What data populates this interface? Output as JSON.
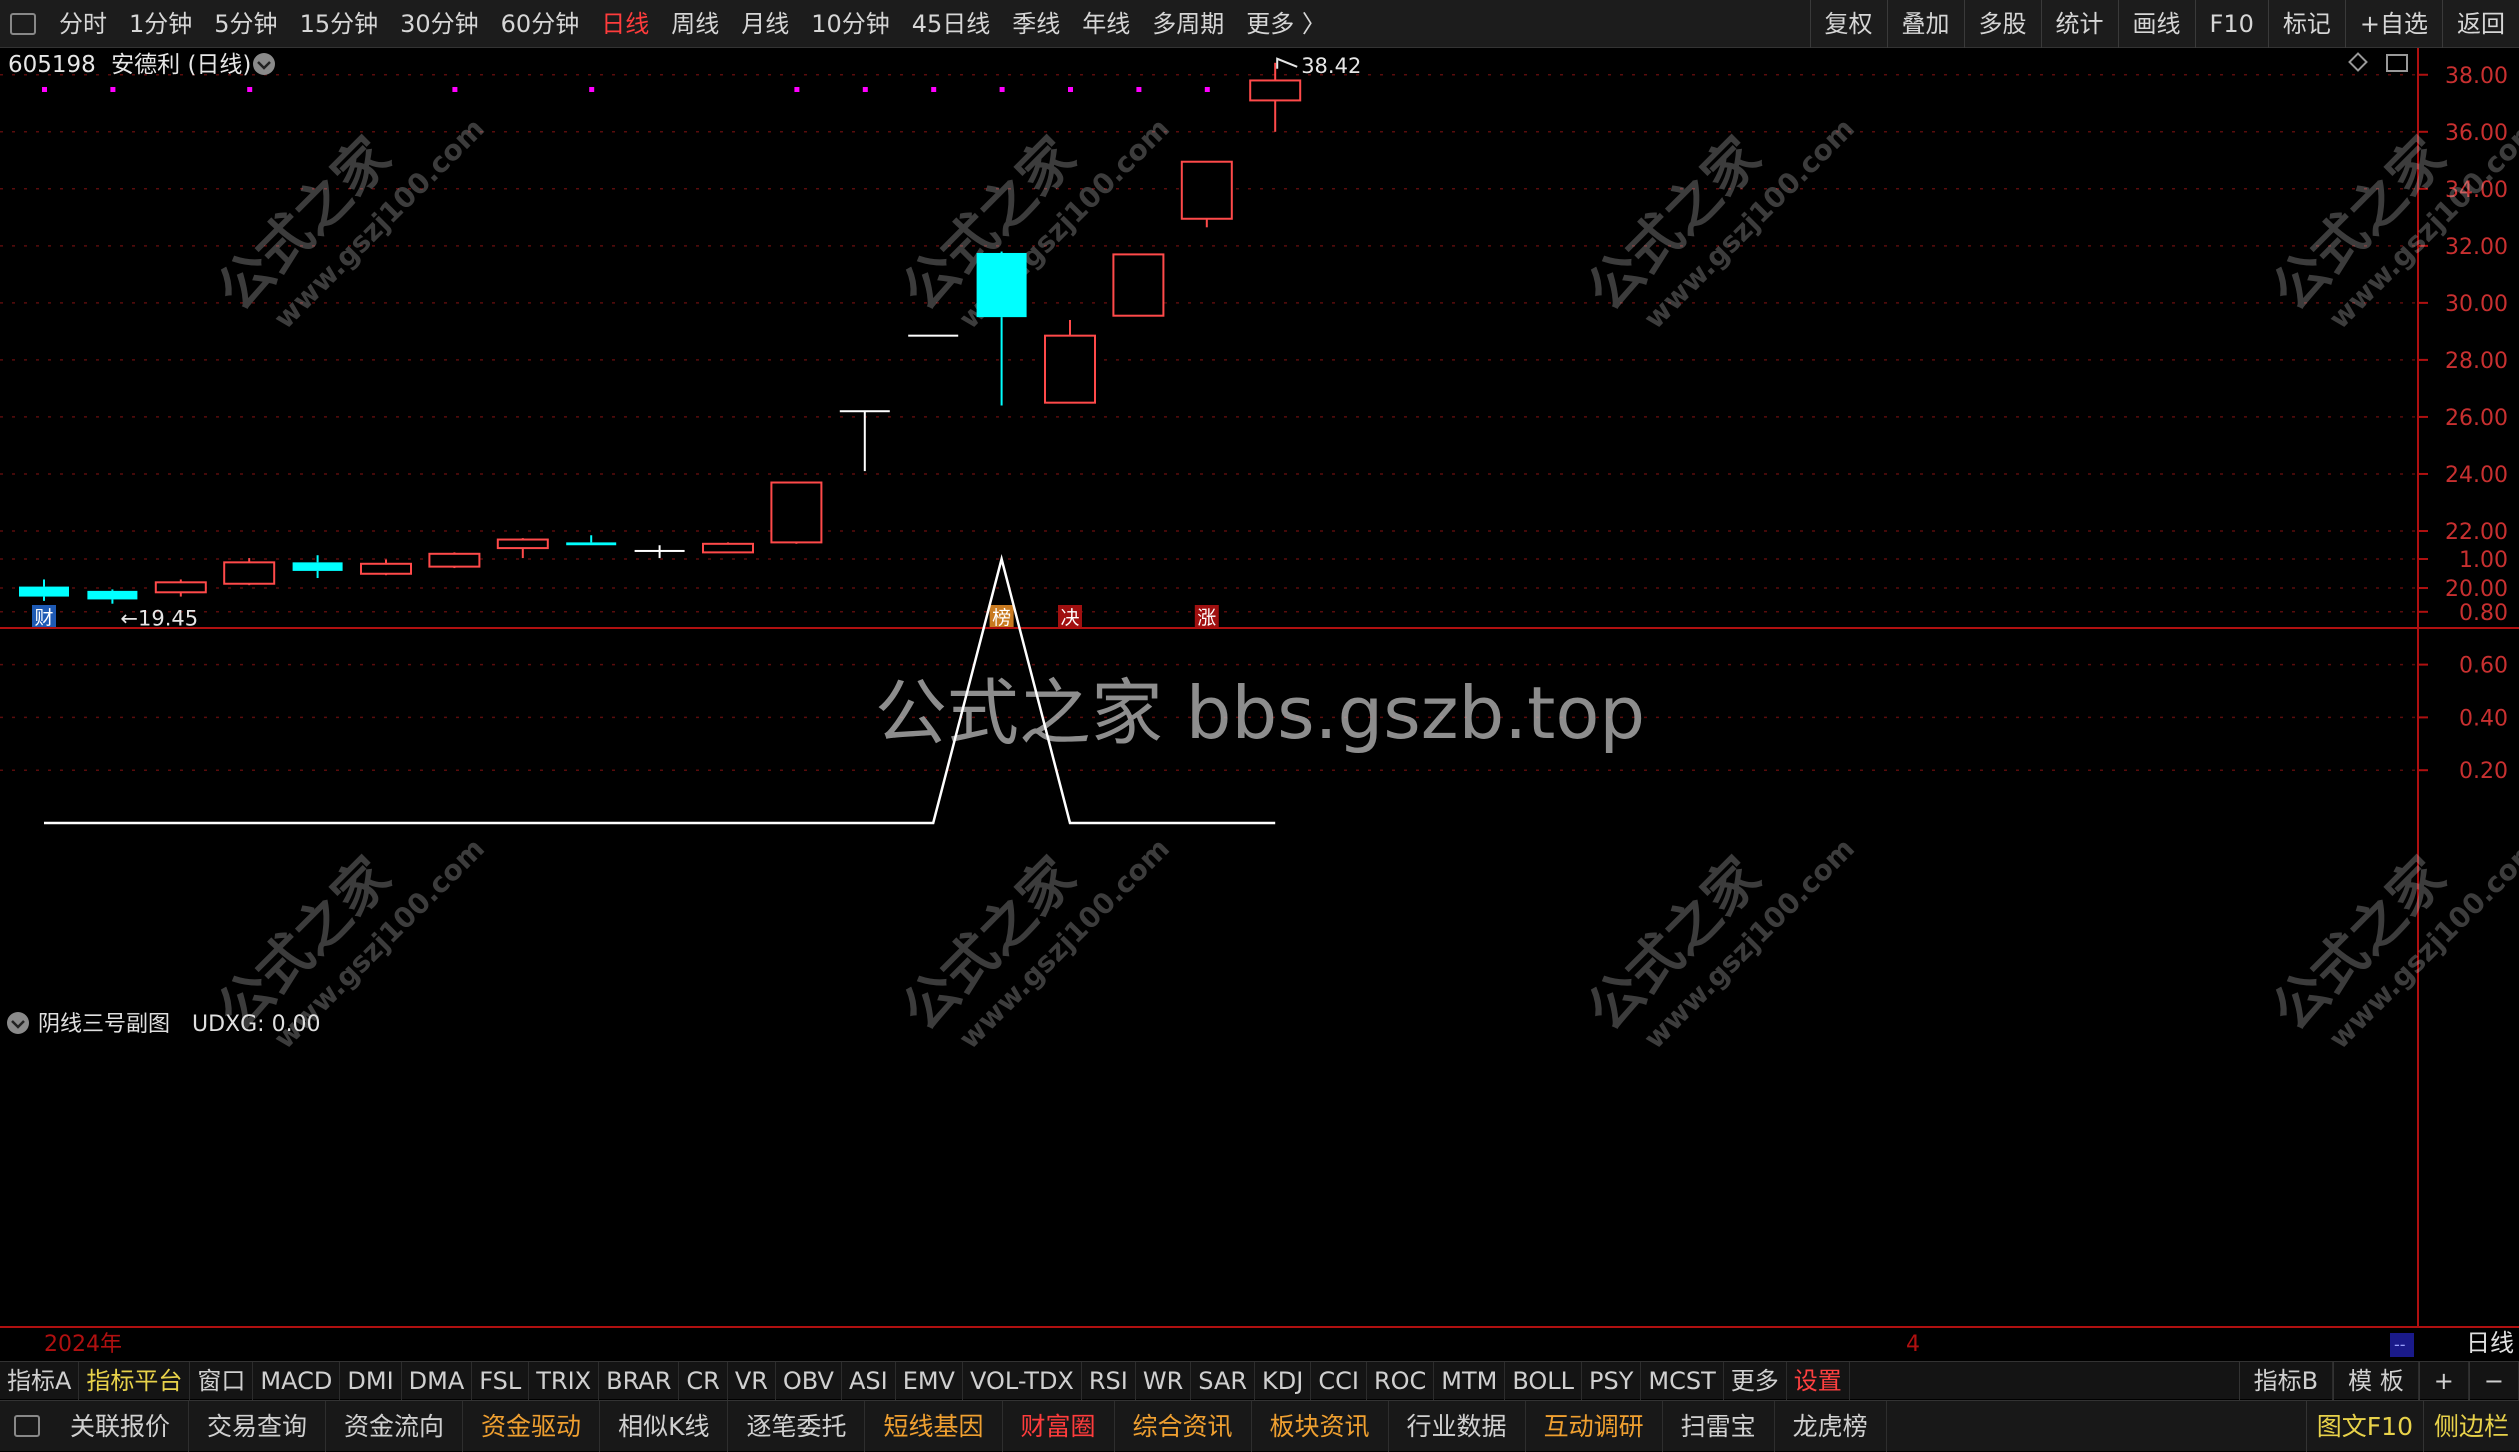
{
  "toolbar": {
    "periods": [
      "分时",
      "1分钟",
      "5分钟",
      "15分钟",
      "30分钟",
      "60分钟",
      "日线",
      "周线",
      "月线",
      "10分钟",
      "45日线",
      "季线",
      "年线",
      "多周期",
      "更多 〉"
    ],
    "active_period": "日线",
    "right": [
      "复权",
      "叠加",
      "多股",
      "统计",
      "画线",
      "F10",
      "标记",
      "+自选",
      "返回"
    ]
  },
  "chart_header": {
    "code": "605198",
    "name": "安德利",
    "period": "(日线)"
  },
  "watermarks": {
    "center": "公式之家 bbs.gszb.top",
    "diag_cn": "公式之家",
    "diag_url": "www.gszj100.com"
  },
  "colors": {
    "up": "#ff4a4a",
    "down": "#00ffff",
    "doji": "#ffffff",
    "axis": "#b01010",
    "marker": "#ff00ff",
    "line": "#ffffff"
  },
  "chart_data": [
    {
      "type": "candlestick",
      "title": "605198 安德利(日线)",
      "ylim": [
        19.0,
        39.0
      ],
      "yticks": [
        "20.00",
        "22.00",
        "24.00",
        "26.00",
        "28.00",
        "30.00",
        "32.00",
        "34.00",
        "36.00",
        "38.00"
      ],
      "candles": [
        {
          "o": 20.05,
          "c": 19.7,
          "h": 20.3,
          "l": 19.55
        },
        {
          "o": 19.9,
          "c": 19.6,
          "h": 19.95,
          "l": 19.45
        },
        {
          "o": 19.85,
          "c": 20.2,
          "h": 20.3,
          "l": 19.7
        },
        {
          "o": 20.15,
          "c": 20.9,
          "h": 21.05,
          "l": 20.1
        },
        {
          "o": 20.9,
          "c": 20.6,
          "h": 21.15,
          "l": 20.35
        },
        {
          "o": 20.5,
          "c": 20.85,
          "h": 21.0,
          "l": 20.45
        },
        {
          "o": 20.75,
          "c": 21.2,
          "h": 21.25,
          "l": 20.7
        },
        {
          "o": 21.4,
          "c": 21.7,
          "h": 21.75,
          "l": 21.05
        },
        {
          "o": 21.6,
          "c": 21.5,
          "h": 21.85,
          "l": 21.5
        },
        {
          "o": 21.3,
          "c": 21.3,
          "h": 21.5,
          "l": 21.05
        },
        {
          "o": 21.25,
          "c": 21.55,
          "h": 21.6,
          "l": 21.25
        },
        {
          "o": 21.6,
          "c": 23.7,
          "h": 23.7,
          "l": 21.55
        },
        {
          "o": 26.2,
          "c": 26.2,
          "h": 26.2,
          "l": 24.1
        },
        {
          "o": 28.85,
          "c": 28.85,
          "h": 28.85,
          "l": 28.85
        },
        {
          "o": 31.75,
          "c": 29.5,
          "h": 31.8,
          "l": 26.4
        },
        {
          "o": 26.5,
          "c": 28.85,
          "h": 29.4,
          "l": 26.5
        },
        {
          "o": 29.55,
          "c": 31.7,
          "h": 31.7,
          "l": 29.55
        },
        {
          "o": 32.95,
          "c": 34.95,
          "h": 34.95,
          "l": 32.65
        },
        {
          "o": 37.1,
          "c": 37.8,
          "h": 38.42,
          "l": 36.0
        }
      ],
      "annotations": [
        {
          "index": 1,
          "value": 19.45,
          "text": "←19.45"
        },
        {
          "index": 18,
          "value": 38.42,
          "text": "38.42"
        }
      ],
      "marker_dots": [
        0,
        1,
        3,
        6,
        8,
        11,
        12,
        13,
        14,
        15,
        16,
        17
      ],
      "event_tags": [
        {
          "index": 0,
          "text": "财",
          "color": "#1e5ab4"
        },
        {
          "index": 14,
          "text": "榜",
          "color": "#c87a20"
        },
        {
          "index": 15,
          "text": "决",
          "color": "#a01010"
        },
        {
          "index": 17,
          "text": "涨",
          "color": "#a01010"
        }
      ]
    },
    {
      "type": "line",
      "title": "阴线三号副图",
      "legend": "UDXG: 0.00",
      "ylim": [
        0,
        1.1
      ],
      "yticks": [
        "0.20",
        "0.40",
        "0.60",
        "0.80",
        "1.00"
      ],
      "series": [
        {
          "values": [
            0,
            0,
            0,
            0,
            0,
            0,
            0,
            0,
            0,
            0,
            0,
            0,
            0,
            0,
            1,
            0,
            0,
            0,
            0
          ]
        }
      ]
    }
  ],
  "xaxis": {
    "left_label": "2024年",
    "marker_label": "4",
    "right_period": "日线",
    "corner_box": "--"
  },
  "indicator_bar": {
    "items": [
      "指标A",
      "指标平台",
      "窗口",
      "MACD",
      "DMI",
      "DMA",
      "FSL",
      "TRIX",
      "BRAR",
      "CR",
      "VR",
      "OBV",
      "ASI",
      "EMV",
      "VOL-TDX",
      "RSI",
      "WR",
      "SAR",
      "KDJ",
      "CCI",
      "ROC",
      "MTM",
      "BOLL",
      "PSY",
      "MCST",
      "更多",
      "设置"
    ],
    "right": [
      "指标B",
      "模 板",
      "+",
      "−"
    ]
  },
  "bottom_bar": {
    "items": [
      "关联报价",
      "交易查询",
      "资金流向",
      "资金驱动",
      "相似K线",
      "逐笔委托",
      "短线基因",
      "财富圈",
      "综合资讯",
      "板块资讯",
      "行业数据",
      "互动调研",
      "扫雷宝",
      "龙虎榜"
    ],
    "right": [
      "图文F10",
      "侧边栏"
    ]
  }
}
